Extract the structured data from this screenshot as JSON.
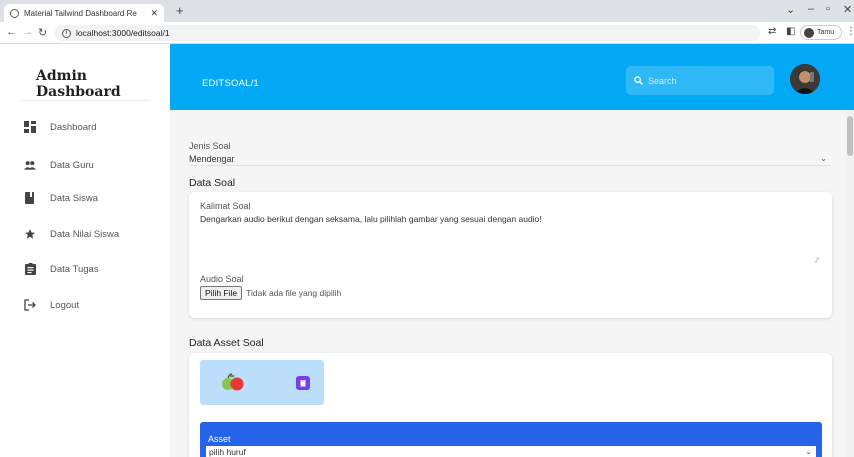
{
  "browser": {
    "tab_title": "Material Tailwind Dashboard Re",
    "url": "localhost:3000/editsoal/1",
    "profile_name": "Tamu"
  },
  "sidebar": {
    "brand": "Admin Dashboard",
    "items": [
      {
        "label": "Dashboard",
        "icon": "dashboard-icon"
      },
      {
        "label": "Data Guru",
        "icon": "people-icon"
      },
      {
        "label": "Data Siswa",
        "icon": "book-icon"
      },
      {
        "label": "Data Nilai Siswa",
        "icon": "star-icon"
      },
      {
        "label": "Data Tugas",
        "icon": "assignment-icon"
      },
      {
        "label": "Logout",
        "icon": "logout-icon"
      }
    ]
  },
  "header": {
    "page_title": "EDITSOAL/1",
    "search_placeholder": "Search"
  },
  "form": {
    "jenis_soal_label": "Jenis Soal",
    "jenis_soal_value": "Mendengar",
    "data_soal_title": "Data Soal",
    "kalimat_label": "Kalimat Soal",
    "kalimat_value": "Dengarkan audio berikut dengan seksama, lalu pilihlah gambar yang sesuai dengan audio!",
    "audio_label": "Audio Soal",
    "file_button": "Pilih File",
    "file_status": "Tidak ada file yang dipilih",
    "asset_section_title": "Data Asset Soal",
    "asset_label": "Asset",
    "asset_select_value": "pilih huruf"
  },
  "colors": {
    "header": "#03a9f4",
    "asset_panel": "#2563eb",
    "delete_button": "#7c3aed"
  }
}
